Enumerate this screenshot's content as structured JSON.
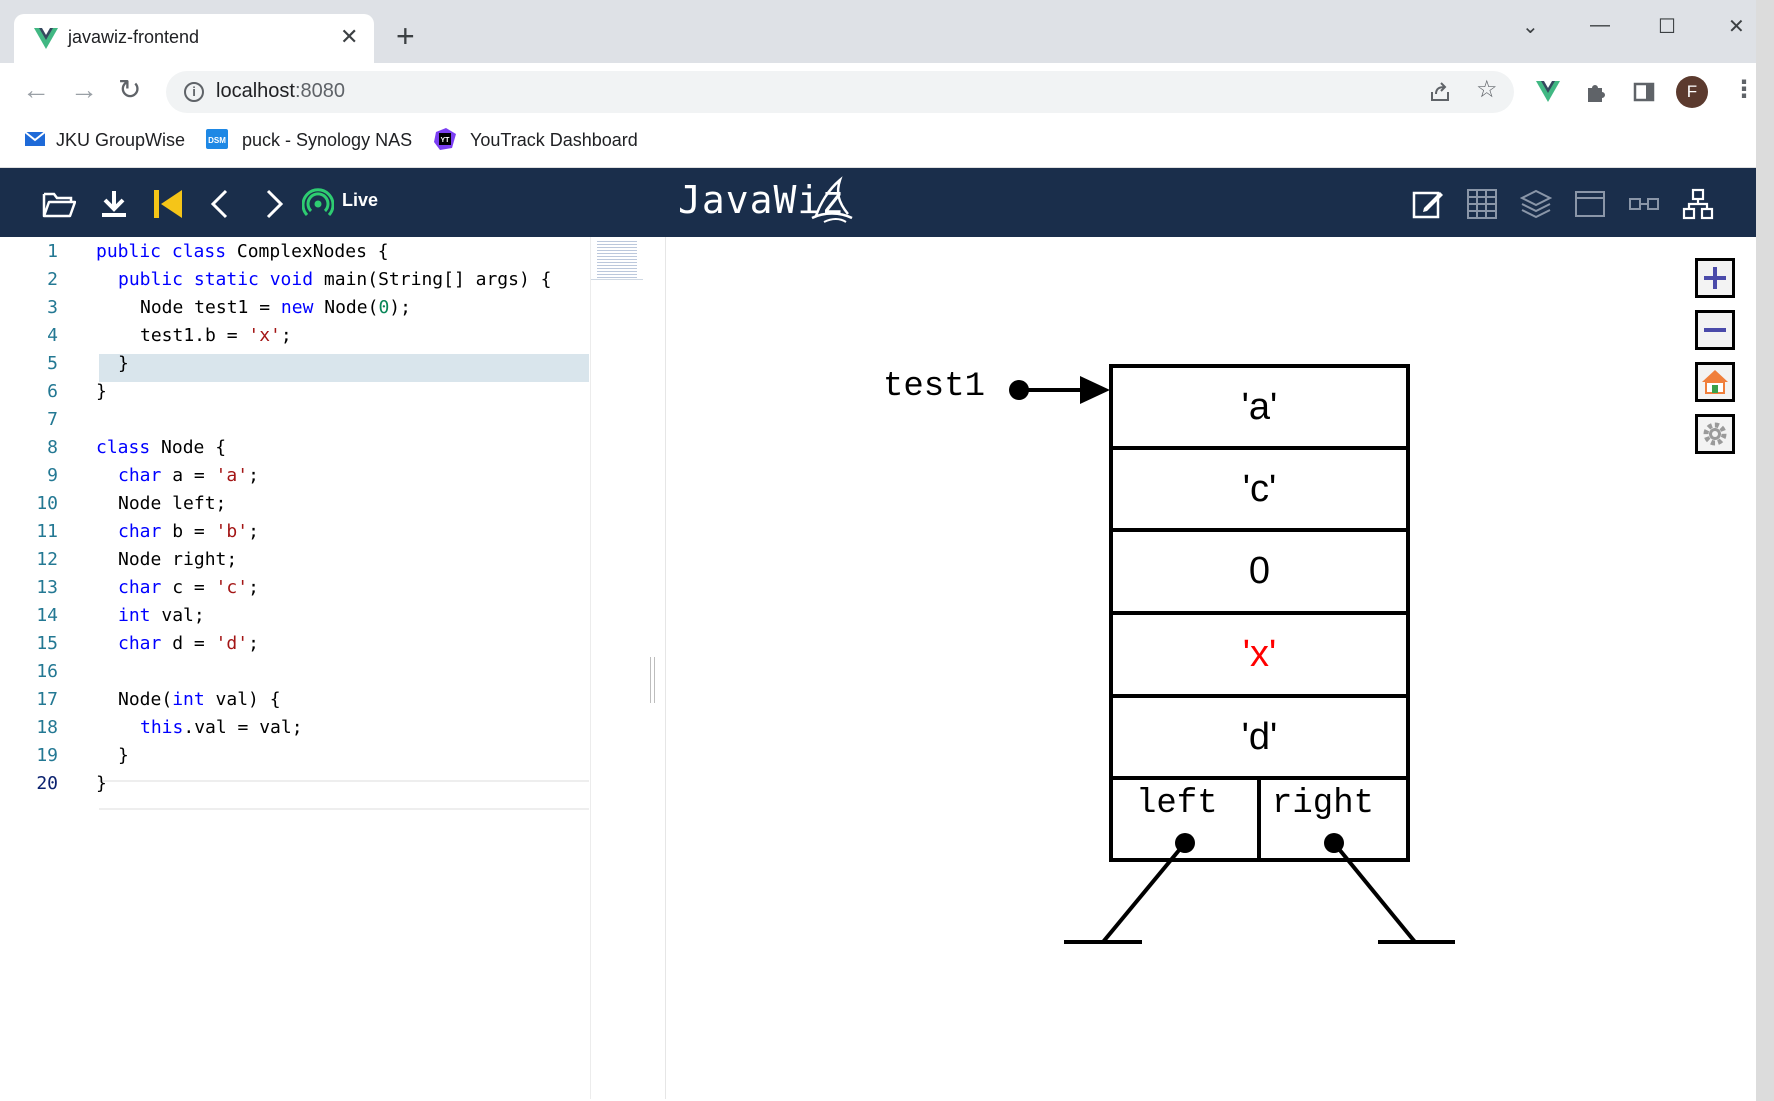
{
  "browser": {
    "tab_title": "javawiz-frontend",
    "tab_close": "✕",
    "new_tab": "+",
    "url_host": "localhost",
    "url_port": ":8080",
    "avatar_letter": "F",
    "window_minimize": "—",
    "window_maximize": "☐",
    "window_close": "✕",
    "tab_search": "⌄",
    "bookmarks": [
      {
        "label": "JKU GroupWise"
      },
      {
        "label": "puck - Synology NAS"
      },
      {
        "label": "YouTrack Dashboard"
      }
    ]
  },
  "app": {
    "brand": "JavaWiz",
    "live_label": "Live",
    "colors": {
      "header": "#1a2e4b",
      "live": "#2ecc71",
      "first_step": "#f5c518"
    }
  },
  "editor": {
    "line_numbers": [
      "1",
      "2",
      "3",
      "4",
      "5",
      "6",
      "7",
      "8",
      "9",
      "10",
      "11",
      "12",
      "13",
      "14",
      "15",
      "16",
      "17",
      "18",
      "19",
      "20"
    ]
  },
  "viz": {
    "variable": "test1",
    "fields": [
      "'a'",
      "'c'",
      "0",
      "'x'",
      "'d'"
    ],
    "changed_field_color": "#ff0000",
    "ref_fields": [
      "left",
      "right"
    ]
  }
}
